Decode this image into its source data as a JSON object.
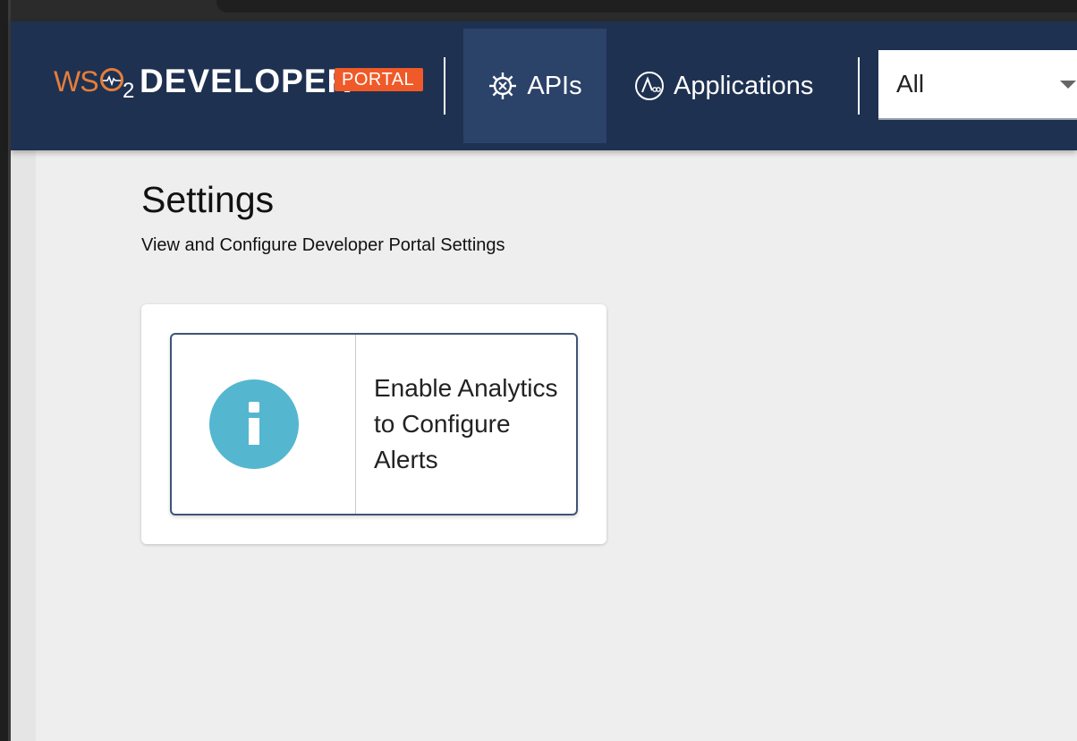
{
  "logo": {
    "ws": "WS",
    "two": "2",
    "developer": "DEVELOPER",
    "portal": "PORTAL",
    "brand_color": "#f05a28"
  },
  "nav": {
    "apis_label": "APIs",
    "applications_label": "Applications"
  },
  "scope_select": {
    "value": "All"
  },
  "page": {
    "title": "Settings",
    "subtitle": "View and Configure Developer Portal Settings"
  },
  "alert_card": {
    "icon": "info-icon",
    "message": "Enable Analytics to Configure Alerts"
  },
  "colors": {
    "appbar": "#1e3151",
    "active_nav": "#2b4269",
    "info_icon": "#55b6d0",
    "background": "#eeeeee"
  }
}
